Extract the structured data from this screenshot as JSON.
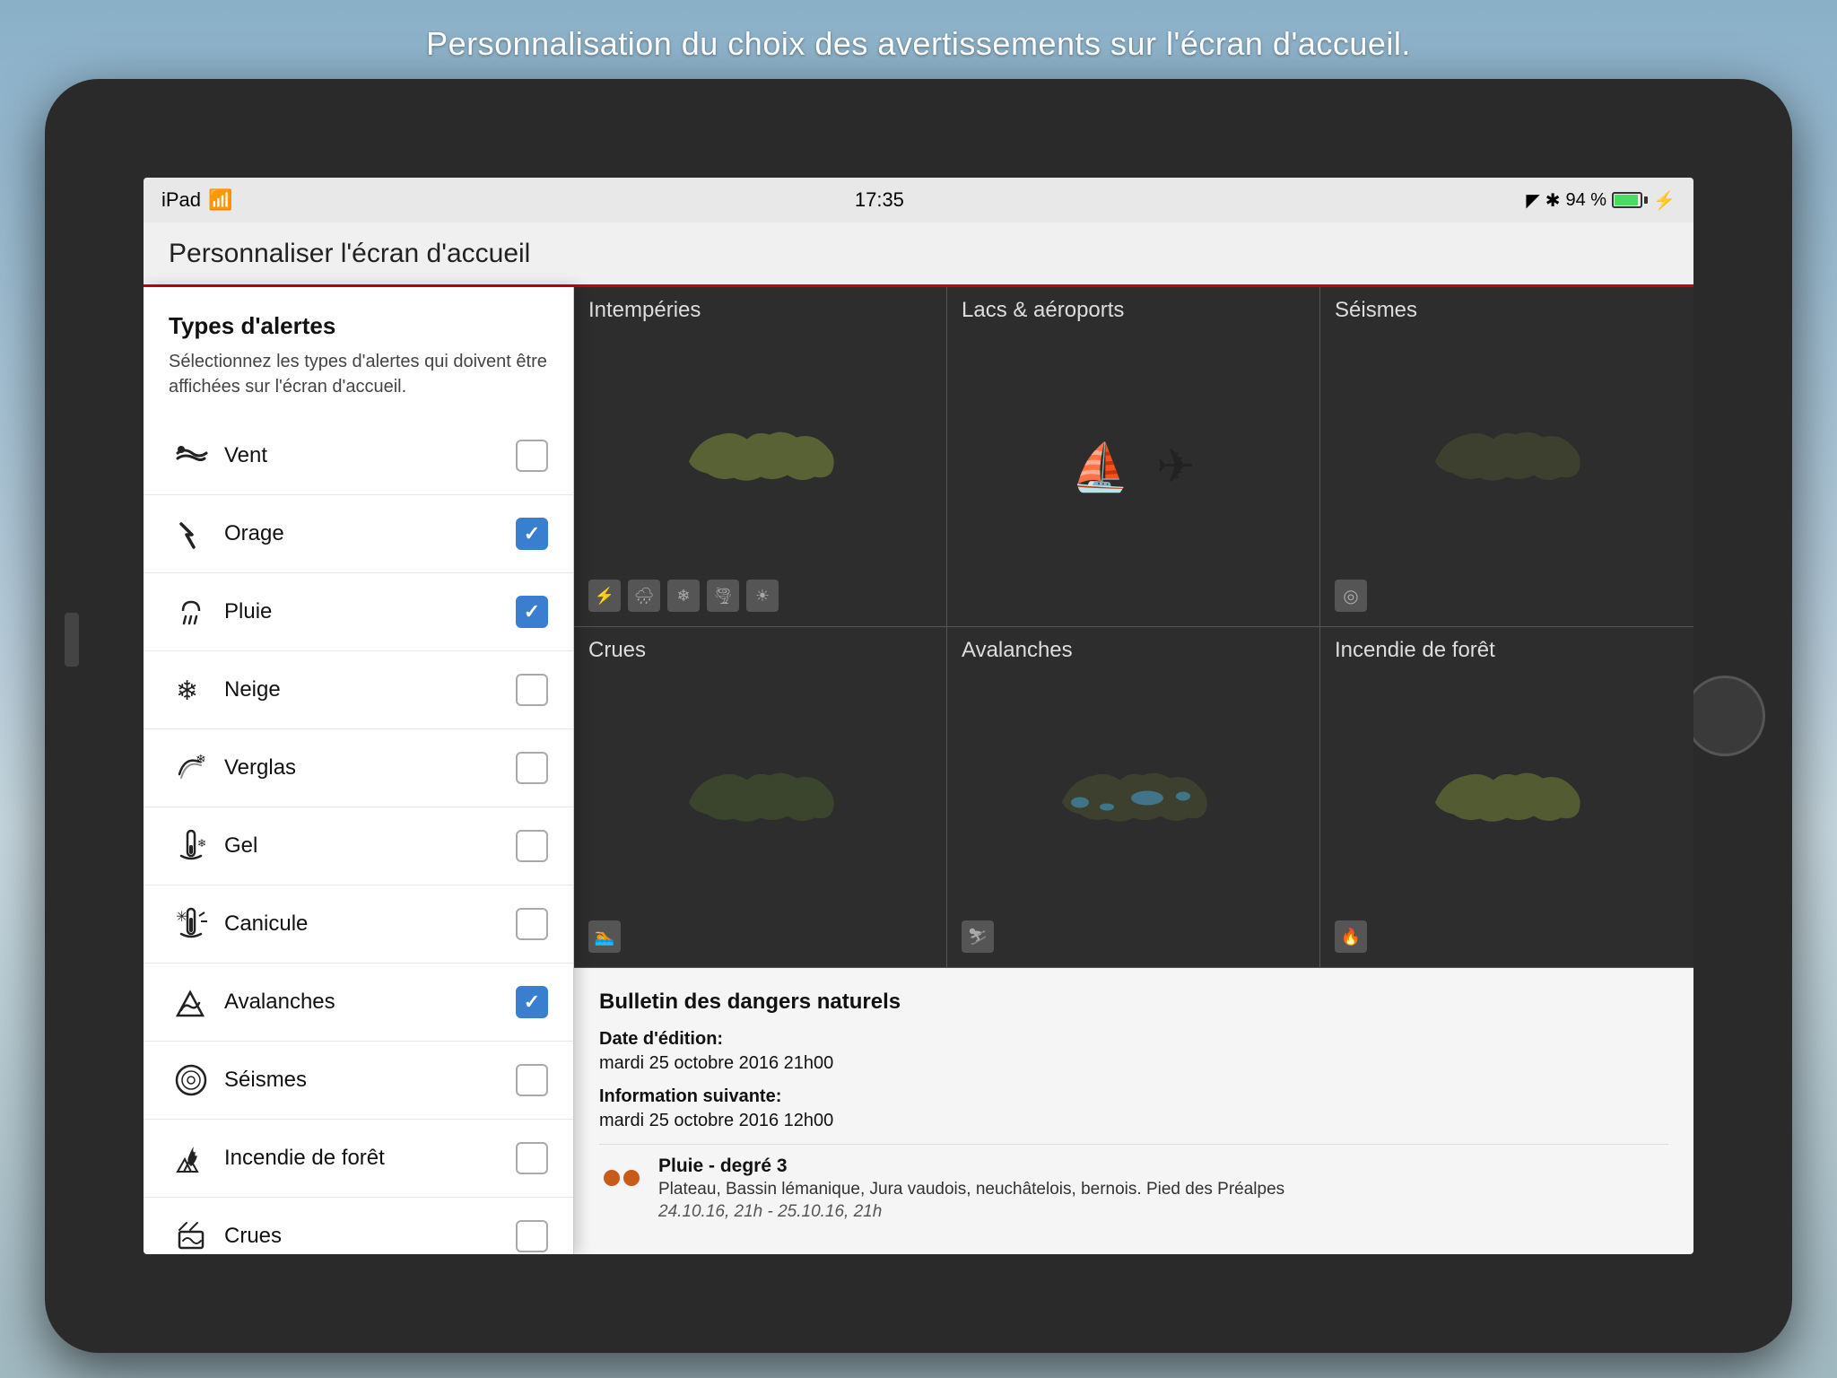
{
  "background": {
    "caption": "Personnalisation du choix des avertissements sur l'écran d'accueil."
  },
  "statusBar": {
    "device": "iPad",
    "wifi": "wifi",
    "time": "17:35",
    "location": "▲",
    "bluetooth": "✱",
    "battery": "94 %"
  },
  "navBar": {
    "title": "Personnaliser l'écran d'accueil"
  },
  "leftPanel": {
    "title": "Types d'alertes",
    "subtitle": "Sélectionnez les types d'alertes qui doivent être affichées sur l'écran d'accueil.",
    "items": [
      {
        "id": "vent",
        "label": "Vent",
        "checked": false,
        "icon": "wind"
      },
      {
        "id": "orage",
        "label": "Orage",
        "checked": true,
        "icon": "storm"
      },
      {
        "id": "pluie",
        "label": "Pluie",
        "checked": true,
        "icon": "rain"
      },
      {
        "id": "neige",
        "label": "Neige",
        "checked": false,
        "icon": "snow"
      },
      {
        "id": "verglas",
        "label": "Verglas",
        "checked": false,
        "icon": "ice"
      },
      {
        "id": "gel",
        "label": "Gel",
        "checked": false,
        "icon": "frost"
      },
      {
        "id": "canicule",
        "label": "Canicule",
        "checked": false,
        "icon": "heatwave"
      },
      {
        "id": "avalanches",
        "label": "Avalanches",
        "checked": true,
        "icon": "avalanche"
      },
      {
        "id": "seismes",
        "label": "Séismes",
        "checked": false,
        "icon": "earthquake"
      },
      {
        "id": "incendie",
        "label": "Incendie de forêt",
        "checked": false,
        "icon": "fire"
      },
      {
        "id": "crues",
        "label": "Crues",
        "checked": false,
        "icon": "flood"
      }
    ]
  },
  "mapGrid": {
    "cells": [
      {
        "id": "intemp",
        "title": "Intempéries",
        "mapType": "green"
      },
      {
        "id": "lacs",
        "title": "Lacs & aéroports",
        "mapType": "icons"
      },
      {
        "id": "seismes",
        "title": "Séismes",
        "mapType": "dark"
      },
      {
        "id": "crues",
        "title": "Crues",
        "mapType": "green2"
      },
      {
        "id": "avalanches",
        "title": "Avalanches",
        "mapType": "blue"
      },
      {
        "id": "incendie",
        "title": "Incendie de forêt",
        "mapType": "yellow"
      }
    ]
  },
  "bulletin": {
    "title": "Bulletin des dangers naturels",
    "editionLabel": "Date d'édition:",
    "editionValue": "mardi 25 octobre 2016 21h00",
    "nextLabel": "Information suivante:",
    "nextValue": "mardi 25 octobre 2016 12h00",
    "alerts": [
      {
        "name": "Pluie - degré 3",
        "region": "Plateau, Bassin lémanique, Jura vaudois, neuchâtelois, bernois. Pied des Préalpes",
        "date": "24.10.16, 21h - 25.10.16, 21h"
      }
    ]
  }
}
